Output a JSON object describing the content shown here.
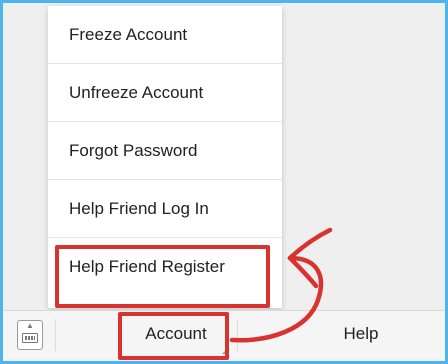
{
  "menu": {
    "items": [
      {
        "label": "Freeze Account"
      },
      {
        "label": "Unfreeze Account"
      },
      {
        "label": "Forgot Password"
      },
      {
        "label": "Help Friend Log In"
      },
      {
        "label": "Help Friend Register"
      }
    ]
  },
  "bottom_bar": {
    "keyboard_icon": "keyboard-icon",
    "tabs": [
      {
        "label": "Account"
      },
      {
        "label": "Help"
      }
    ]
  },
  "annotation": {
    "color": "#d8332f"
  },
  "colors": {
    "frame_border": "#4fb4ec"
  }
}
